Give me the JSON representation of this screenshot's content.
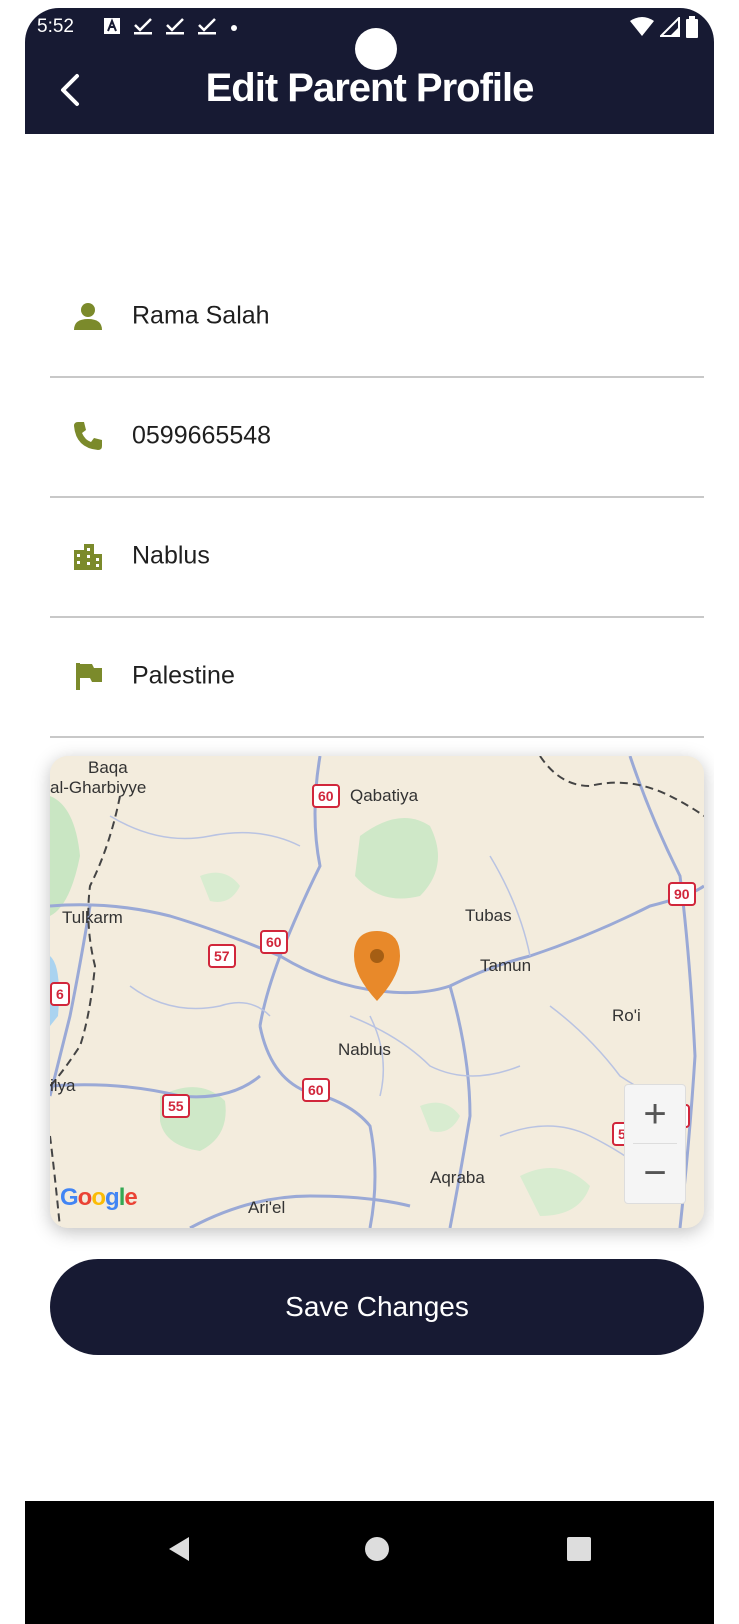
{
  "status_bar": {
    "time": "5:52"
  },
  "header": {
    "title": "Edit Parent Profile"
  },
  "fields": [
    {
      "icon": "person-icon",
      "value": "Rama Salah"
    },
    {
      "icon": "phone-icon",
      "value": "0599665548"
    },
    {
      "icon": "city-icon",
      "value": "Nablus"
    },
    {
      "icon": "flag-icon",
      "value": "Palestine"
    }
  ],
  "map": {
    "labels": {
      "baqa": "Baqa",
      "gharbiyye": "al-Gharbiyye",
      "qabatiya": "Qabatiya",
      "tulkarm": "Tulkarm",
      "tubas": "Tubas",
      "tamun": "Tamun",
      "roi": "Ro'i",
      "nablus": "Nablus",
      "ilya": "ilya",
      "aqraba": "Aqraba",
      "ariel": "Ari'el"
    },
    "shields": {
      "r60a": "60",
      "r90": "90",
      "r57a": "57",
      "r60b": "60",
      "r6": "6",
      "r55": "55",
      "r60c": "60",
      "r57b": "57",
      "r90b": "90"
    },
    "zoom_in": "+",
    "zoom_out": "−",
    "attribution": {
      "g1": "G",
      "o1": "o",
      "o2": "o",
      "g2": "g",
      "l": "l",
      "e": "e"
    }
  },
  "save_button": {
    "label": "Save Changes"
  },
  "colors": {
    "primary": "#171a33",
    "icon": "#7b8a2b",
    "pin": "#e8892a"
  }
}
